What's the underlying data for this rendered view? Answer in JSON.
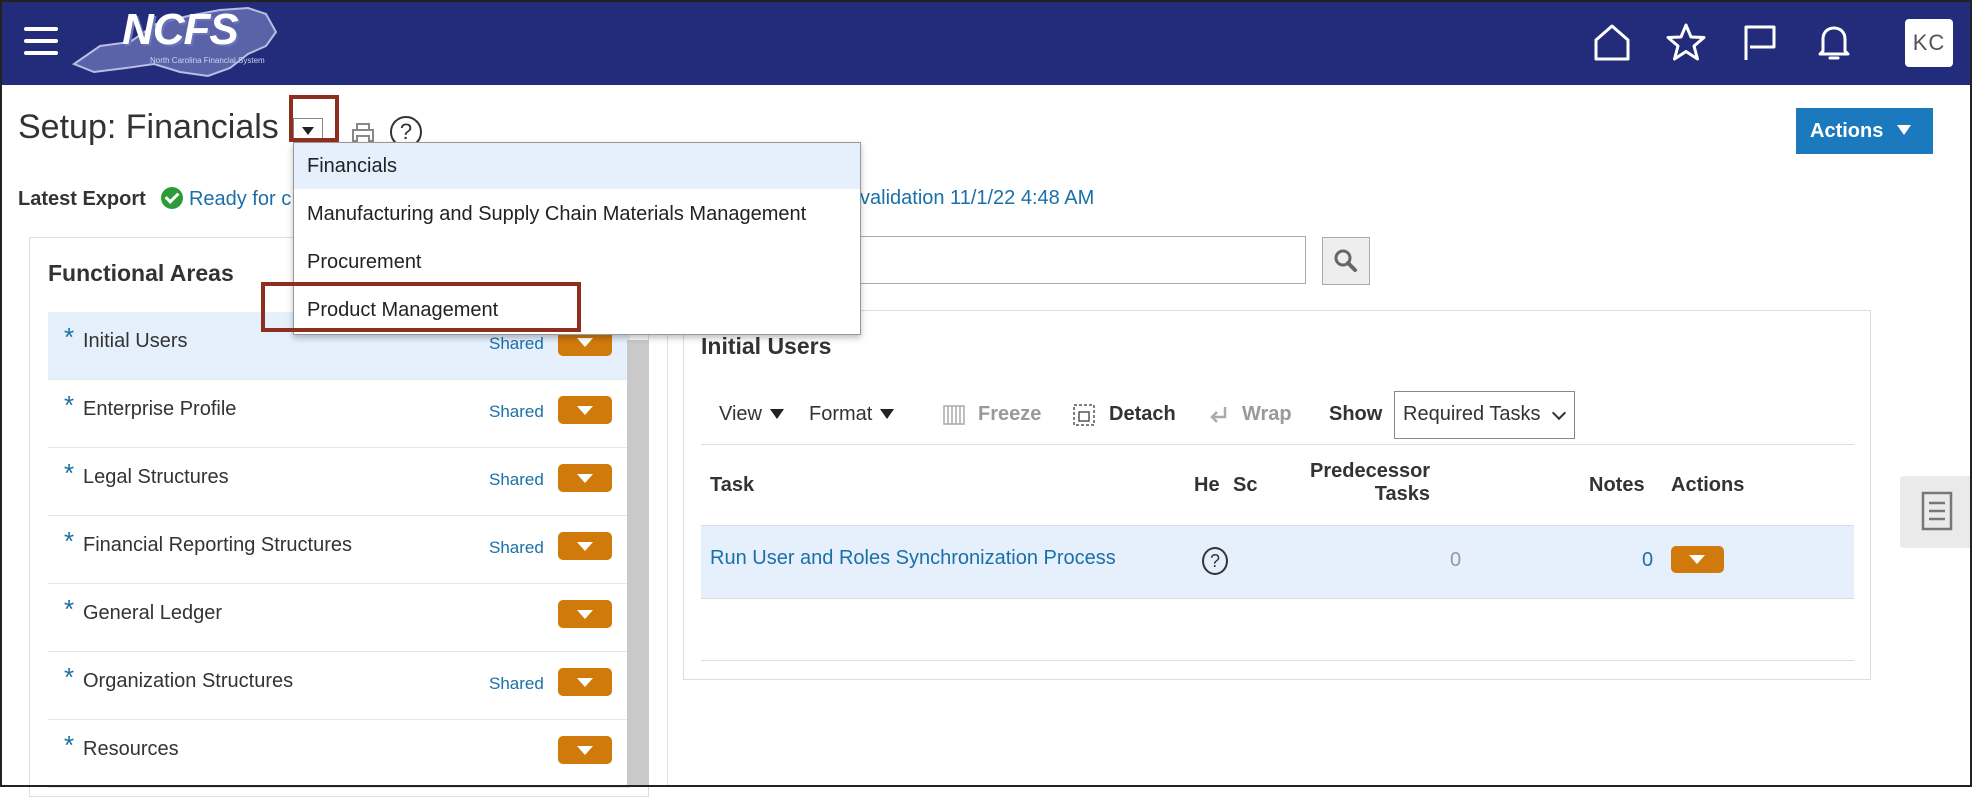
{
  "header": {
    "logo_text": "NCFS",
    "logo_subtext": "North Carolina Financial System",
    "user_initials": "KC"
  },
  "page": {
    "title": "Setup: Financials",
    "actions_label": "Actions",
    "latest_export_label": "Latest Export",
    "export_status": "Ready for c",
    "export_validation": "validation 11/1/22 4:48 AM"
  },
  "title_menu": {
    "items": [
      "Financials",
      "Manufacturing and Supply Chain Materials Management",
      "Procurement",
      "Product Management"
    ]
  },
  "functional_areas": {
    "title": "Functional Areas",
    "items": [
      {
        "label": "Initial Users",
        "shared": "Shared"
      },
      {
        "label": "Enterprise Profile",
        "shared": "Shared"
      },
      {
        "label": "Legal Structures",
        "shared": "Shared"
      },
      {
        "label": "Financial Reporting Structures",
        "shared": "Shared"
      },
      {
        "label": "General Ledger",
        "shared": ""
      },
      {
        "label": "Organization Structures",
        "shared": "Shared"
      },
      {
        "label": "Resources",
        "shared": ""
      }
    ],
    "required_marker": "*"
  },
  "tasks_panel": {
    "title": "Initial Users",
    "toolbar": {
      "view": "View",
      "format": "Format",
      "freeze": "Freeze",
      "detach": "Detach",
      "wrap": "Wrap",
      "show_label": "Show",
      "show_value": "Required Tasks"
    },
    "columns": {
      "task": "Task",
      "help": "He",
      "scope": "Sc",
      "predecessor_line1": "Predecessor",
      "predecessor_line2": "Tasks",
      "notes": "Notes",
      "actions": "Actions"
    },
    "rows": [
      {
        "task": "Run User and Roles Synchronization Process",
        "predecessor_tasks": "0",
        "notes": "0"
      }
    ]
  },
  "colors": {
    "header_bg": "#232c7a",
    "accent_blue": "#1a7abd",
    "link_blue": "#1b6fa8",
    "action_orange": "#d07a0c",
    "selection_bg": "#e5f0fc",
    "highlight_box": "#8e2e1e"
  }
}
